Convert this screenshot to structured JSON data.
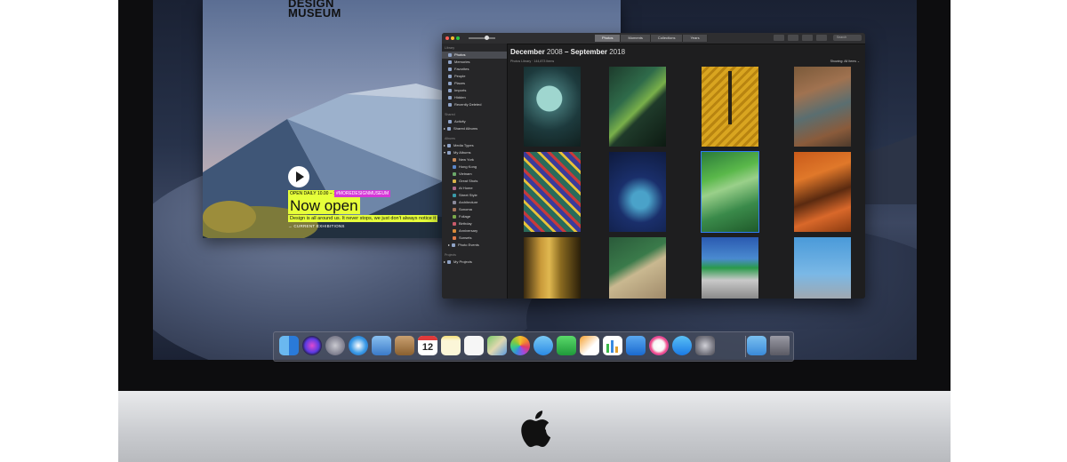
{
  "museum_page": {
    "logo_line1": "DESIGN",
    "logo_line2": "MUSEUM",
    "tag_hours": "OPEN DAILY 10.00 – 18.00",
    "tag_site": "#MOREDESIGNMUSEUM",
    "headline": "Now open",
    "subline": "Design is all around us. It never stops, we just don't always notice it",
    "cta": "CURRENT EXHIBITIONS"
  },
  "photos_app": {
    "toolbar": {
      "tabs": [
        "Photos",
        "Moments",
        "Collections",
        "Years"
      ],
      "selected_tab": "Photos",
      "search_placeholder": "Search"
    },
    "sidebar": {
      "library_header": "Library",
      "library_items": [
        "Photos",
        "Memories",
        "Favorites",
        "People",
        "Places",
        "Imports",
        "Hidden",
        "Recently Deleted"
      ],
      "shared_header": "Shared",
      "shared_items": [
        "Activity",
        "Shared Albums"
      ],
      "albums_header": "Albums",
      "album_items": [
        "Media Types",
        "My Albums",
        "New York",
        "Hong Kong",
        "Vietnam",
        "Great Shots",
        "At Home",
        "Street Style",
        "Architecture",
        "Sonoma",
        "Foliage",
        "Birthday",
        "Anniversary",
        "Sunsets",
        "Photo Events"
      ],
      "projects_header": "Projects",
      "project_items": [
        "My Projects"
      ]
    },
    "main": {
      "title_month1": "December",
      "title_year1": "2008",
      "title_dash": "–",
      "title_month2": "September",
      "title_year2": "2018",
      "subtitle": "Photos Library · 144,873 Items",
      "showing": "Showing: All Items ⌄"
    },
    "thumbnails": [
      {
        "name": "teal-circle"
      },
      {
        "name": "green-steps"
      },
      {
        "name": "yellow-shadow"
      },
      {
        "name": "rust-wall"
      },
      {
        "name": "zigzag-stripes"
      },
      {
        "name": "blue-fountain"
      },
      {
        "name": "green-pool"
      },
      {
        "name": "orange-stairs"
      },
      {
        "name": "gold-curtain"
      },
      {
        "name": "concrete-edge"
      },
      {
        "name": "building-top"
      },
      {
        "name": "statue-sky"
      }
    ]
  },
  "dock": {
    "apps": [
      "Finder",
      "Siri",
      "Launchpad",
      "Safari",
      "Mail",
      "Contacts",
      "Calendar",
      "Notes",
      "Reminders",
      "Maps",
      "Photos",
      "Messages",
      "FaceTime",
      "Pages",
      "Numbers",
      "Keynote",
      "iTunes",
      "App Store",
      "System Preferences",
      "Downloads",
      "Trash"
    ],
    "calendar_day": "12"
  }
}
